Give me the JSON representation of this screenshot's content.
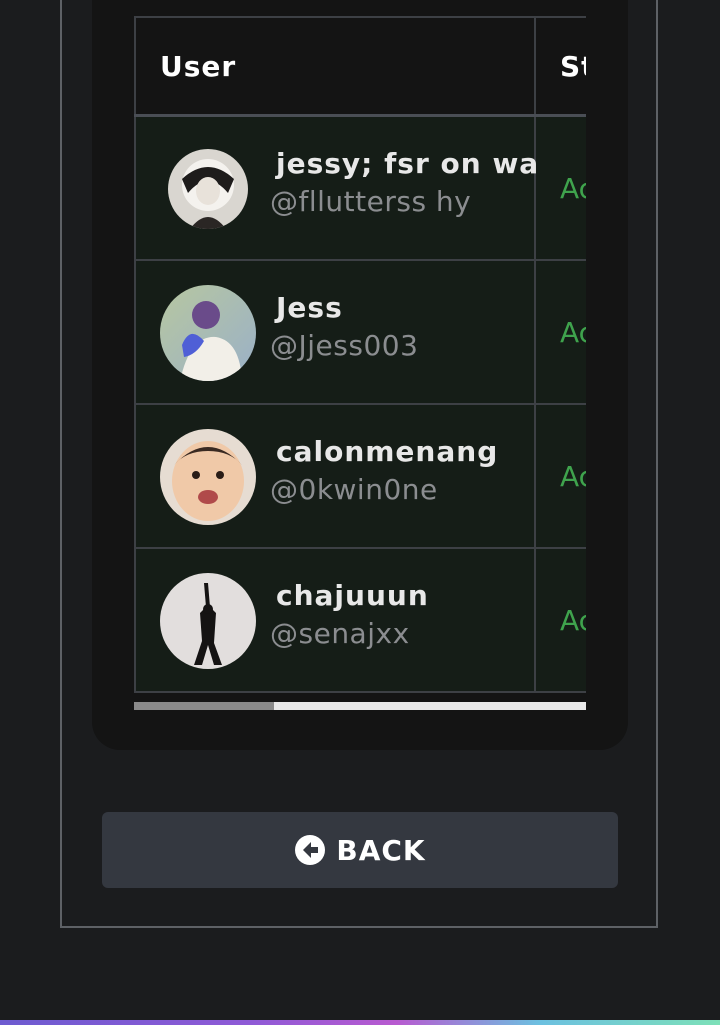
{
  "table": {
    "headers": {
      "user": "User",
      "status": "Status"
    },
    "rows": [
      {
        "display_name": "jessy; fsr on wa",
        "handle": "@fllutterss hy",
        "status": "Active"
      },
      {
        "display_name": "Jess",
        "handle": "@Jjess003",
        "status": "Active"
      },
      {
        "display_name": "calonmenang",
        "handle": "@0kwin0ne",
        "status": "Active"
      },
      {
        "display_name": "chajuuun",
        "handle": "@senajxx",
        "status": "Active"
      }
    ]
  },
  "actions": {
    "back_label": "BACK",
    "back_icon": "arrow-circle-left-icon"
  },
  "colors": {
    "status_active": "#3fa34d",
    "row_background": "#151d17",
    "button_background": "#343840"
  }
}
